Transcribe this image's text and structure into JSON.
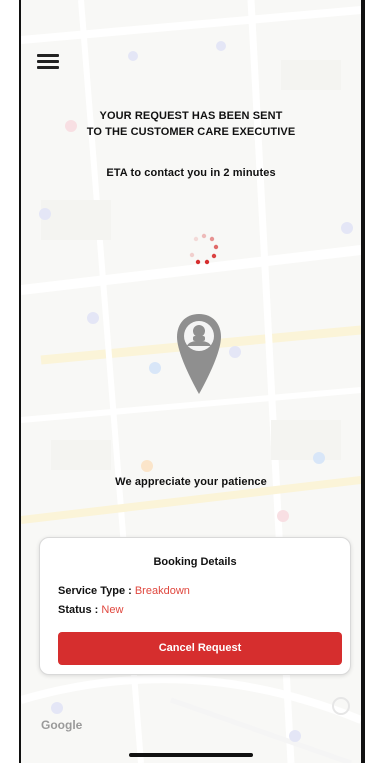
{
  "map": {
    "watermark": "Google"
  },
  "header": {
    "menu_icon": "hamburger-menu-icon"
  },
  "status": {
    "line1": "YOUR REQUEST HAS BEEN SENT",
    "line2": "TO THE CUSTOMER CARE EXECUTIVE",
    "eta": "ETA to contact you in 2 minutes",
    "patience": "We appreciate your patience"
  },
  "booking": {
    "title": "Booking Details",
    "service_type_label": "Service Type :",
    "service_type_value": "Breakdown",
    "status_label": "Status :",
    "status_value": "New",
    "cancel_label": "Cancel Request"
  },
  "colors": {
    "accent": "#d62e2e",
    "value_text": "#e0473e"
  }
}
